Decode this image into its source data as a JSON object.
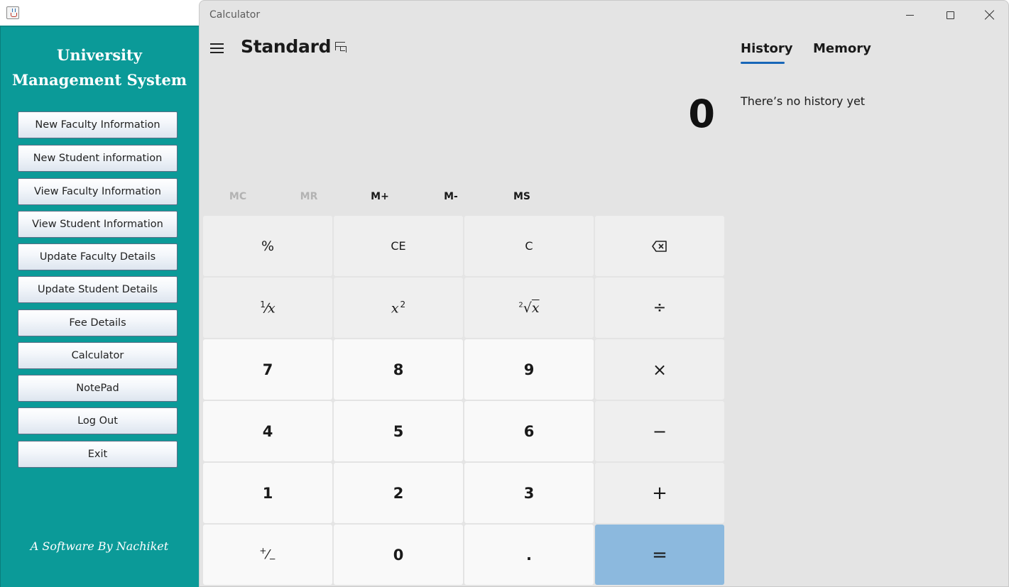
{
  "java_app": {
    "title_line1": "University",
    "title_line2": "Management System",
    "buttons": [
      "New Faculty Information",
      "New Student information",
      "View Faculty Information",
      "View Student Information",
      "Update Faculty Details",
      "Update Student Details",
      "Fee Details",
      "Calculator",
      "NotePad",
      "Log Out",
      "Exit"
    ],
    "credit": "A Software By Nachiket",
    "colors": {
      "sidebar": "#0b9a98"
    }
  },
  "calculator": {
    "window_title": "Calculator",
    "mode": "Standard",
    "display_value": "0",
    "memory_buttons": [
      {
        "label": "MC",
        "enabled": false
      },
      {
        "label": "MR",
        "enabled": false
      },
      {
        "label": "M+",
        "enabled": true
      },
      {
        "label": "M-",
        "enabled": true
      },
      {
        "label": "MS",
        "enabled": true
      }
    ],
    "keys": {
      "percent": "%",
      "ce": "CE",
      "c": "C",
      "backspace_icon": "backspace-icon",
      "reciprocal_num": "1",
      "reciprocal_den": "x",
      "square_base": "x",
      "square_exp": "2",
      "sqrt_index": "2",
      "sqrt_radicand": "x",
      "divide": "÷",
      "seven": "7",
      "eight": "8",
      "nine": "9",
      "multiply": "×",
      "four": "4",
      "five": "5",
      "six": "6",
      "minus": "−",
      "one": "1",
      "two": "2",
      "three": "3",
      "plus": "+",
      "negate_plus": "+",
      "negate_minus": "−",
      "zero": "0",
      "decimal": ".",
      "equals": "="
    },
    "panel": {
      "tab_history": "History",
      "tab_memory": "Memory",
      "empty_message": "There’s no history yet"
    },
    "colors": {
      "accent": "#1866b8",
      "equals": "#8cb9de"
    }
  }
}
